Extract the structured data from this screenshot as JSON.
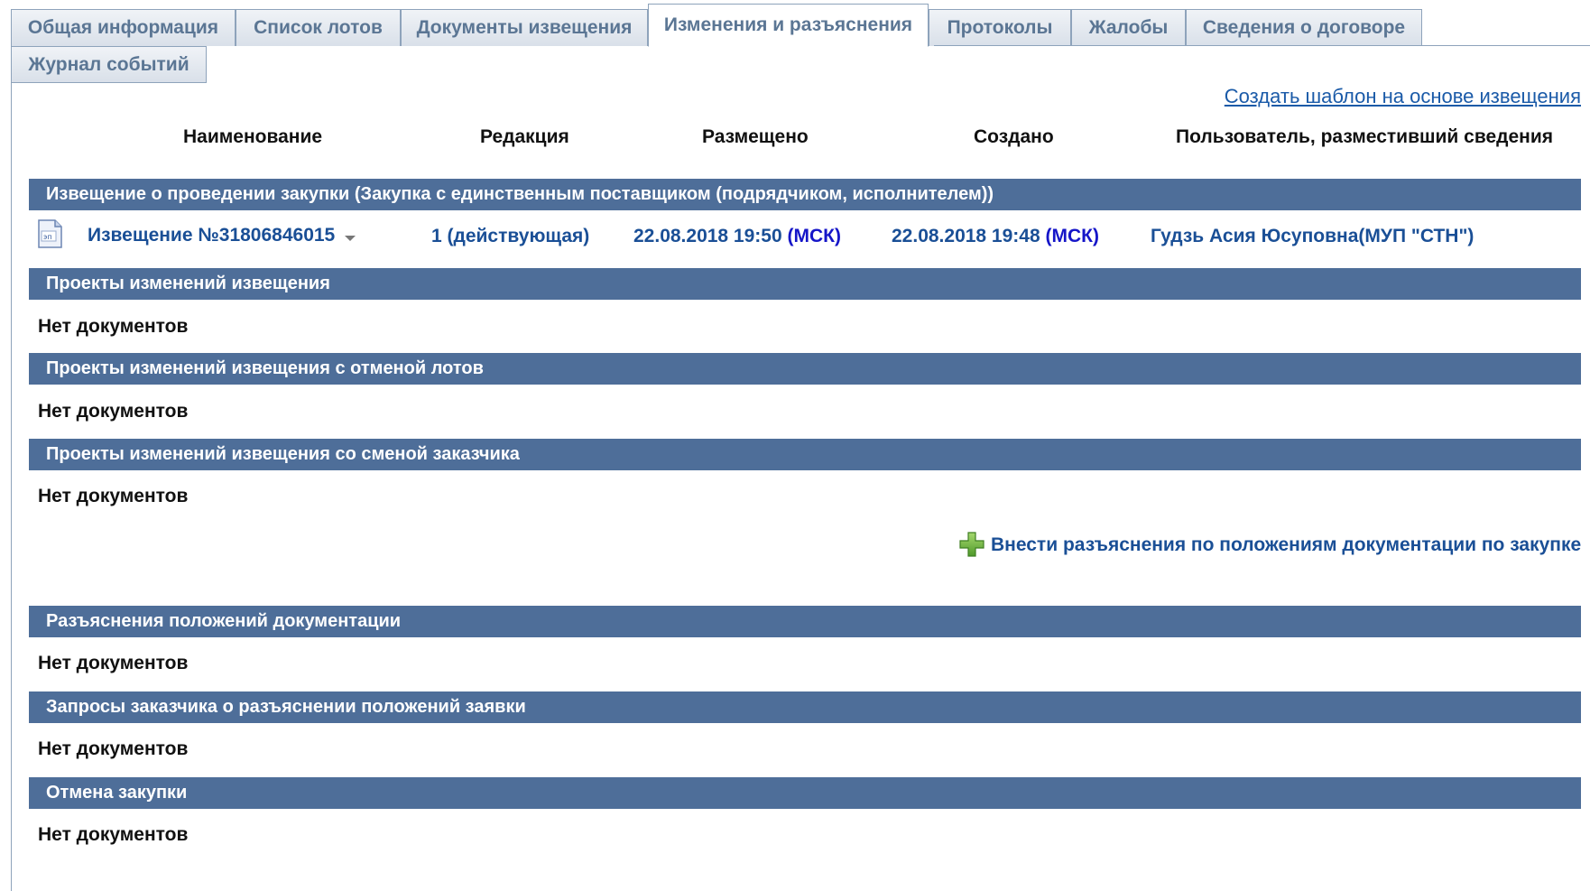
{
  "tabs": {
    "general": "Общая информация",
    "lots": "Список лотов",
    "notice_docs": "Документы извещения",
    "changes": "Изменения и разъяснения",
    "protocols": "Протоколы",
    "complaints": "Жалобы",
    "contract": "Сведения о договоре",
    "events": "Журнал событий"
  },
  "actions": {
    "create_template": "Создать шаблон на основе извещения",
    "add_clarification": "Внести разъяснения по положениям документации по закупке"
  },
  "columns": {
    "name": "Наименование",
    "edition": "Редакция",
    "posted": "Размещено",
    "created": "Создано",
    "user": "Пользователь, разместивший сведения"
  },
  "sections": {
    "notice": "Извещение о проведении закупки (Закупка с единственным поставщиком (подрядчиком, исполнителем))",
    "change_projects": "Проекты изменений извещения",
    "change_projects_lots": "Проекты изменений извещения с отменой лотов",
    "change_projects_customer": "Проекты изменений извещения со сменой заказчика",
    "clarifications": "Разъяснения положений документации",
    "customer_requests": "Запросы заказчика о разъяснении положений заявки",
    "cancel": "Отмена закупки"
  },
  "notice_row": {
    "name": "Извещение №31806846015",
    "edition": "1 (действующая)",
    "posted_date": "22.08.2018 19:50",
    "posted_tz": "(МСК)",
    "created_date": "22.08.2018 19:48",
    "created_tz": "(МСК)",
    "user": "Гудзь Асия Юсуповна(МУП \"СТН\")"
  },
  "empty_text": "Нет документов",
  "colors": {
    "section_bar": "#4e6e99",
    "link": "#1a4f96",
    "tz": "#1515c8",
    "tab_text": "#5b7694"
  }
}
